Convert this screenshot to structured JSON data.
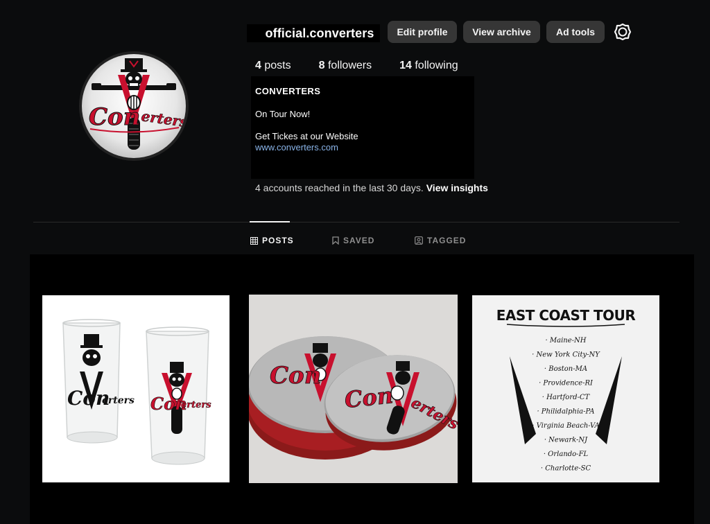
{
  "profile": {
    "username": "official.converters",
    "avatar_alt": "Converters logo"
  },
  "actions": {
    "edit_profile": "Edit profile",
    "view_archive": "View archive",
    "ad_tools": "Ad tools",
    "settings_icon": "gear-icon"
  },
  "stats": {
    "posts_count": "4",
    "posts_label": "posts",
    "followers_count": "8",
    "followers_label": "followers",
    "following_count": "14",
    "following_label": "following"
  },
  "bio": {
    "name": "CONVERTERS",
    "line1": "On Tour Now!",
    "line2": "Get Tickes at our Website",
    "link": "www.converters.com"
  },
  "insights": {
    "text": "4 accounts reached in the last 30 days.",
    "link": "View insights"
  },
  "tabs": [
    {
      "label": "POSTS",
      "icon": "grid-icon",
      "active": true
    },
    {
      "label": "SAVED",
      "icon": "bookmark-icon",
      "active": false
    },
    {
      "label": "TAGGED",
      "icon": "tag-icon",
      "active": false
    }
  ],
  "posts": [
    {
      "description": "glasses"
    },
    {
      "description": "coasters"
    },
    {
      "title": "EAST COAST TOUR",
      "cities": [
        "· Maine-NH",
        "· New York City-NY",
        "· Boston-MA",
        "· Providence-RI",
        "· Hartford-CT",
        "· Philidalphia-PA",
        "· Virginia Beach-VA",
        "· Newark-NJ",
        "· Orlando-FL",
        "· Charlotte-SC"
      ]
    }
  ],
  "logo_text": "ConVerters",
  "colors": {
    "background": "#0b0c0d",
    "button": "#363636",
    "link": "#8ab4e8",
    "brand_red": "#c8102e"
  }
}
